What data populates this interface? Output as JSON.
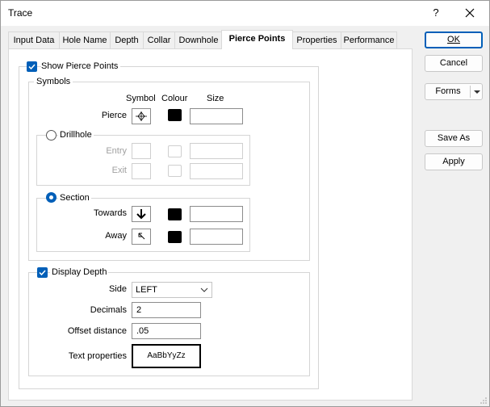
{
  "window": {
    "title": "Trace",
    "help_glyph": "?"
  },
  "tabs": [
    {
      "label": "Input Data"
    },
    {
      "label": "Hole Name"
    },
    {
      "label": "Depth"
    },
    {
      "label": "Collar"
    },
    {
      "label": "Downhole"
    },
    {
      "label": "Pierce Points",
      "active": true
    },
    {
      "label": "Properties"
    },
    {
      "label": "Performance"
    }
  ],
  "pierce": {
    "show_label": "Show Pierce Points",
    "show_checked": true,
    "symbols": {
      "title": "Symbols",
      "col_symbol": "Symbol",
      "col_colour": "Colour",
      "col_size": "Size",
      "pierce_label": "Pierce",
      "pierce_size": "",
      "drillhole": {
        "label": "Drillhole",
        "selected": false,
        "entry_label": "Entry",
        "exit_label": "Exit",
        "entry_size": "",
        "exit_size": ""
      },
      "section": {
        "label": "Section",
        "selected": true,
        "towards_label": "Towards",
        "away_label": "Away",
        "towards_size": "",
        "away_size": ""
      }
    },
    "display_depth": {
      "label": "Display Depth",
      "checked": true,
      "side_label": "Side",
      "side_value": "LEFT",
      "decimals_label": "Decimals",
      "decimals_value": "2",
      "offset_label": "Offset distance",
      "offset_value": ".05",
      "textprops_label": "Text properties",
      "textprops_sample": "AaBbYyZz"
    }
  },
  "buttons": {
    "ok": "OK",
    "cancel": "Cancel",
    "forms": "Forms",
    "save_as": "Save As",
    "apply": "Apply"
  },
  "colors": {
    "accent": "#005fb8",
    "swatch": "#000000"
  }
}
